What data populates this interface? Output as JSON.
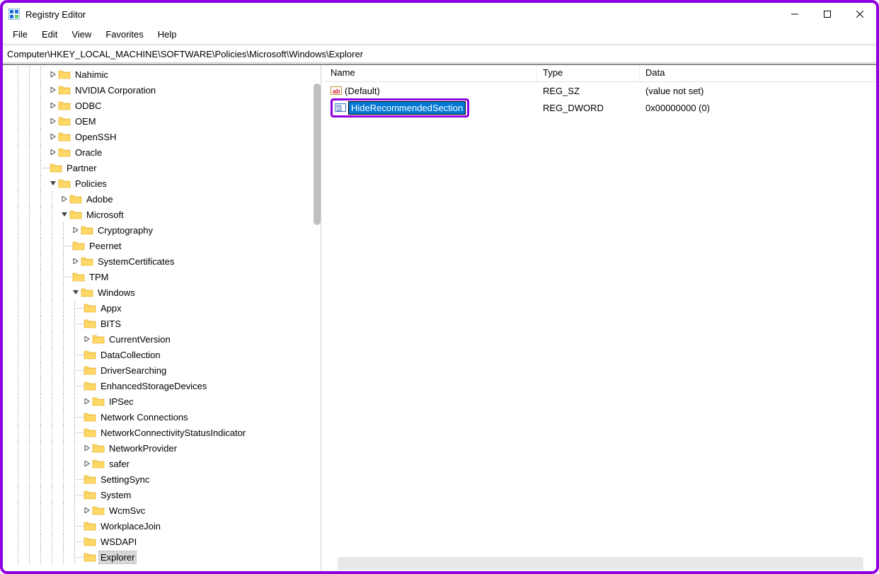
{
  "window": {
    "title": "Registry Editor"
  },
  "menus": [
    "File",
    "Edit",
    "View",
    "Favorites",
    "Help"
  ],
  "address": "Computer\\HKEY_LOCAL_MACHINE\\SOFTWARE\\Policies\\Microsoft\\Windows\\Explorer",
  "tree": [
    {
      "depth": 4,
      "arrow": ">",
      "label": "Nahimic"
    },
    {
      "depth": 4,
      "arrow": ">",
      "label": "NVIDIA Corporation"
    },
    {
      "depth": 4,
      "arrow": ">",
      "label": "ODBC"
    },
    {
      "depth": 4,
      "arrow": ">",
      "label": "OEM"
    },
    {
      "depth": 4,
      "arrow": ">",
      "label": "OpenSSH"
    },
    {
      "depth": 4,
      "arrow": ">",
      "label": "Oracle"
    },
    {
      "depth": 4,
      "arrow": "",
      "label": "Partner"
    },
    {
      "depth": 4,
      "arrow": "v",
      "label": "Policies"
    },
    {
      "depth": 5,
      "arrow": ">",
      "label": "Adobe"
    },
    {
      "depth": 5,
      "arrow": "v",
      "label": "Microsoft"
    },
    {
      "depth": 6,
      "arrow": ">",
      "label": "Cryptography"
    },
    {
      "depth": 6,
      "arrow": "",
      "label": "Peernet"
    },
    {
      "depth": 6,
      "arrow": ">",
      "label": "SystemCertificates"
    },
    {
      "depth": 6,
      "arrow": "",
      "label": "TPM"
    },
    {
      "depth": 6,
      "arrow": "v",
      "label": "Windows"
    },
    {
      "depth": 7,
      "arrow": "",
      "label": "Appx"
    },
    {
      "depth": 7,
      "arrow": "",
      "label": "BITS"
    },
    {
      "depth": 7,
      "arrow": ">",
      "label": "CurrentVersion"
    },
    {
      "depth": 7,
      "arrow": "",
      "label": "DataCollection"
    },
    {
      "depth": 7,
      "arrow": "",
      "label": "DriverSearching"
    },
    {
      "depth": 7,
      "arrow": "",
      "label": "EnhancedStorageDevices"
    },
    {
      "depth": 7,
      "arrow": ">",
      "label": "IPSec"
    },
    {
      "depth": 7,
      "arrow": "",
      "label": "Network Connections"
    },
    {
      "depth": 7,
      "arrow": "",
      "label": "NetworkConnectivityStatusIndicator"
    },
    {
      "depth": 7,
      "arrow": ">",
      "label": "NetworkProvider"
    },
    {
      "depth": 7,
      "arrow": ">",
      "label": "safer"
    },
    {
      "depth": 7,
      "arrow": "",
      "label": "SettingSync"
    },
    {
      "depth": 7,
      "arrow": "",
      "label": "System"
    },
    {
      "depth": 7,
      "arrow": ">",
      "label": "WcmSvc"
    },
    {
      "depth": 7,
      "arrow": "",
      "label": "WorkplaceJoin"
    },
    {
      "depth": 7,
      "arrow": "",
      "label": "WSDAPI"
    },
    {
      "depth": 7,
      "arrow": "",
      "label": "Explorer",
      "selected": true
    }
  ],
  "columns": {
    "name": "Name",
    "type": "Type",
    "data": "Data"
  },
  "values": [
    {
      "icon": "ab",
      "name": "(Default)",
      "type": "REG_SZ",
      "data": "(value not set)",
      "editing": false
    },
    {
      "icon": "bin",
      "name": "HideRecommendedSection",
      "type": "REG_DWORD",
      "data": "0x00000000 (0)",
      "editing": true,
      "highlighted": true
    }
  ]
}
